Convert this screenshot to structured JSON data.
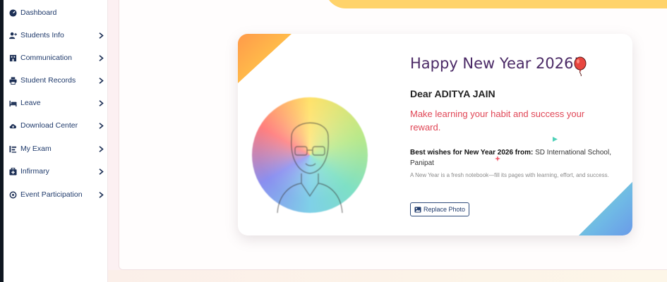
{
  "sidebar": {
    "items": [
      {
        "label": "Dashboard",
        "icon": "dashboard-icon",
        "has_chevron": false
      },
      {
        "label": "Students Info",
        "icon": "user-plus-icon",
        "has_chevron": true
      },
      {
        "label": "Communication",
        "icon": "building-icon",
        "has_chevron": true
      },
      {
        "label": "Student Records",
        "icon": "printer-icon",
        "has_chevron": true
      },
      {
        "label": "Leave",
        "icon": "bed-icon",
        "has_chevron": true
      },
      {
        "label": "Download Center",
        "icon": "cloud-download-icon",
        "has_chevron": true
      },
      {
        "label": "My Exam",
        "icon": "exam-icon",
        "has_chevron": true
      },
      {
        "label": "Infirmary",
        "icon": "first-aid-icon",
        "has_chevron": true
      },
      {
        "label": "Event Participation",
        "icon": "circle-dot-icon",
        "has_chevron": true
      }
    ]
  },
  "card": {
    "title": "Happy New Year 2026!",
    "greeting": "Dear ADITYA JAIN",
    "message": "Make learning your habit and success your reward.",
    "wishes_label": "Best wishes for New Year 2026 from:",
    "wishes_from": "SD International School, Panipat",
    "note": "A New Year is a fresh notebook—fill its pages with learning, effort, and success.",
    "replace_button": "Replace Photo"
  },
  "colors": {
    "title": "#4b2a66",
    "message": "#e04555",
    "nav_text": "#1f3a6b",
    "banner": "#ffd36b"
  }
}
